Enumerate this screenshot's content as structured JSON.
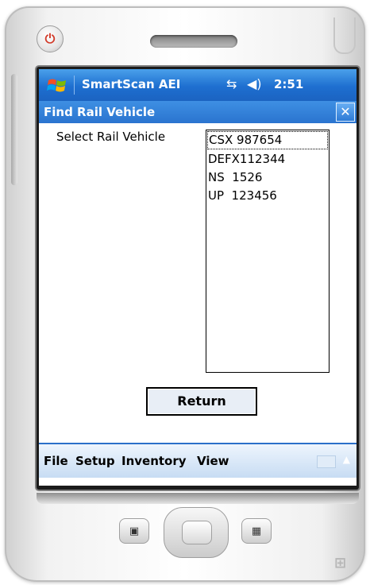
{
  "taskbar": {
    "app_title": "SmartScan AEI",
    "clock": "2:51",
    "icons": [
      "windows-start-icon",
      "network-icon",
      "volume-icon"
    ]
  },
  "dialog": {
    "title": "Find Rail Vehicle",
    "close_label": "✕"
  },
  "form": {
    "select_label": "Select Rail Vehicle",
    "vehicles": [
      "CSX 987654",
      "DEFX112344",
      "NS  1526",
      "UP  123456"
    ],
    "selected_index": 0,
    "return_label": "Return"
  },
  "menubar": {
    "items": [
      "File",
      "Setup",
      "Inventory",
      "View"
    ],
    "keyboard_icon": "keyboard-icon"
  },
  "colors": {
    "titlebar": "#1e6fd0",
    "menubar_border": "#2b70c9"
  }
}
